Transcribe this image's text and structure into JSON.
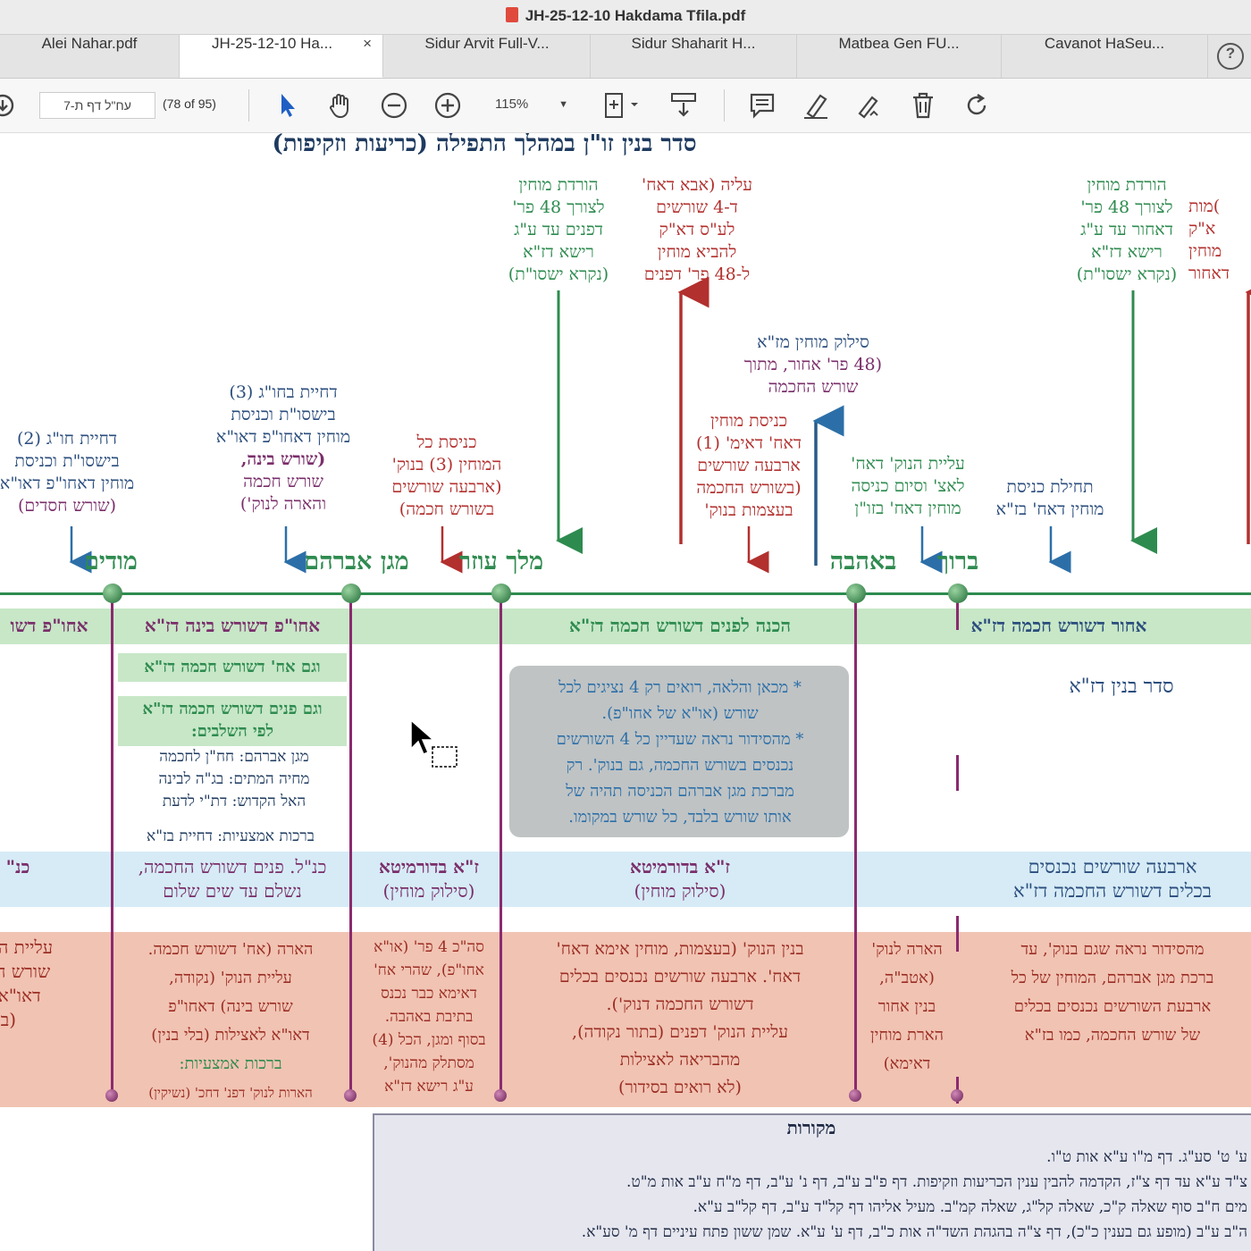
{
  "window": {
    "title": "JH-25-12-10 Hakdama Tfila.pdf"
  },
  "tabs": [
    {
      "label": "Alei Nahar.pdf"
    },
    {
      "label": "JH-25-12-10 Ha...",
      "active": true
    },
    {
      "label": "Sidur Arvit Full-V..."
    },
    {
      "label": "Sidur Shaharit H..."
    },
    {
      "label": "Matbea Gen FU..."
    },
    {
      "label": "Cavanot HaSeu..."
    }
  ],
  "toolbar": {
    "page_input": "עח\"ל דף ת-7",
    "page_count": "(78 of 95)",
    "zoom": "115%"
  },
  "doc": {
    "title": "סדר בנין זו\"ן במהלך התפילה (כריעות וזקיפות)",
    "top_labels": {
      "horadat1": [
        "הורדת מוחין",
        "לצורך 48 פר'",
        "דפנים עד ע\"ג",
        "רישא דז\"א",
        "(נקרא ישסו\"ת)"
      ],
      "aliya": [
        "עליה (אבא דאח'",
        "ד-4 שורשים",
        "לע\"ס דא\"ק",
        "להביא מוחין",
        "ל-48 פר' דפנים"
      ],
      "horadat2": [
        "הורדת מוחין",
        "לצורך 48 פר'",
        "דאחור עד ע\"ג",
        "רישא דז\"א",
        "(נקרא ישסו\"ת)"
      ],
      "edge_right": [
        ")מות",
        "א\"ק",
        "מוחין",
        "דאחור"
      ],
      "silluk": [
        "סילוק מוחין מז\"א",
        "(48 פר' אחור, מתוך",
        "שורש החכמה"
      ],
      "knisat_mochin": [
        "כניסת מוחין",
        "דאח' דאימ' (1)",
        "ארבעה שורשים",
        "(בשורש החכמה",
        "בעצמות בנוק'"
      ],
      "dchiyat3": [
        "דחיית בחו\"ג (3)",
        "בישסו\"ת וכניסת",
        "מוחין דאחו\"פ דאו\"א",
        "(שורש בינה,",
        "שורש חכמה",
        "והארה לנוק')"
      ],
      "dchiyat2": [
        "דחיית חו\"ג (2)",
        "בישסו\"ת וכניסת",
        "מוחין דאחו\"פ דאו\"א",
        "(שורש חסדים)"
      ],
      "knisat_kol": [
        "כניסת כל",
        "המוחין (3) בנוק'",
        "(ארבעה שורשים",
        "בשורש חכמה)"
      ],
      "aliyat_nukva": [
        "עליית הנוק' דאח'",
        "לאצ' וסיום כניסה",
        "מוחין דאח' בזו\"ן"
      ],
      "tchilat": [
        "תחילת כניסת",
        "מוחין דאח' בז\"א"
      ]
    },
    "stems": [
      "מודים",
      "מגן אברהם",
      "מלך עוזר",
      "באהבה",
      "ברוך"
    ],
    "band1": {
      "c1": "אחו\"פ דשו",
      "c2": "אחו\"פ דשורש בינה דז\"א",
      "c3": "הכנה לפנים דשורש חכמה דז\"א",
      "c4": "אחור דשורש חכמה דז\"א"
    },
    "side_notes": {
      "n1": "וגם אח' דשורש חכמה דז\"א",
      "n2a": "וגם פנים דשורש חכמה דז\"א",
      "n2b": "לפי השלבים:",
      "n3": [
        "מגן אברהם: חח\"ן לחכמה",
        "מחיה המתים: בג\"ה לבינה",
        "האל הקדוש: דת\"י לדעת"
      ],
      "n4": "ברכות אמצעיות: דחיית בז\"א"
    },
    "greybox": [
      "* מכאן והלאה, רואים רק 4 נציגים לכל",
      "שורש (או\"א של אחו\"פ).",
      "* מהסידור נראה שעדיין כל 4 השורשים",
      "נכנסים בשורש החכמה, גם בנוק'. רק",
      "מברכת מגן אברהם הכניסה תהיה של",
      "אותו שורש בלבד, כל שורש במקומו."
    ],
    "seder_binyan": "סדר בנין דז\"א",
    "band2": {
      "c1": "כנ\"",
      "c2a": "כנ\"ל. פנים דשורש החכמה,",
      "c2b": "נשלם עד שים שלום",
      "c3a": "ז\"א בדורמיטא",
      "c3b": "(סילוק מוחין)",
      "c4a": "ז\"א בדורמיטא",
      "c4b": "(סילוק מוחין)",
      "c5a": "ארבעה שורשים נכנסים",
      "c5b": "בכלים דשורש החכמה דז\"א"
    },
    "band3": {
      "c1": [
        "עליית הנוק'",
        "שורש חס')",
        "דאו\"א לא",
        "(בלי ב"
      ],
      "c2": [
        "הארה (אח' דשורש חכמה.",
        "עליית הנוק' (נקודה,",
        "שורש בינה) דאחו\"פ",
        "דאו\"א לאצילות (בלי בנין)",
        "ברכות אמצעיות:",
        "הארות לנוק' דפנ' דחכ' (נשיקין)"
      ],
      "c3": [
        "סה\"כ 4 פר' (או\"א",
        "אחו\"פ), שהרי אח'",
        "דאימא כבר נכנס",
        "בתיבת באהבה.",
        "בסוף ומגן, הכל (4)",
        "מסתלק מהנוק',",
        "ע\"ג רישא דז\"א"
      ],
      "c4": [
        "בנין הנוק' (בעצמות, מוחין אימא דאח'",
        "דאח'. ארבעה שורשים נכנסים בכלים",
        "דשורש החכמה דנוק').",
        "עליית הנוק' דפנים (בתור נקודה),",
        "מהבריאה לאצילות",
        "(לא רואים בסידור)"
      ],
      "c5": [
        "הארה לנוק'",
        "(אטב\"ה,",
        "בנין אחור",
        "הארת מוחין",
        "דאימא)"
      ],
      "c6": [
        "מהסידור נראה שגם בנוק', עד",
        "ברכת מגן אברהם, המוחין של כל",
        "ארבעת השורשים נכנסים בכלים",
        "של שורש החכמה, כמו בז\"א"
      ]
    },
    "sources": {
      "title": "מקורות",
      "lines": [
        "ע' ט' סע\"ג. דף מ\"ו ע\"א אות ט\"ו.",
        "צ\"ד ע\"א עד דף צ\"ז, הקדמה להבין ענין הכריעות וזקיפות. דף פ\"ב ע\"ב, דף נ' ע\"ב, דף מ\"ח ע\"ב אות מ\"ט.",
        "מים ח\"ב סוף שאלה ק\"כ, שאלה קל\"ג, שאלה קמ\"ב. מעיל אליהו דף קל\"ד ע\"ב, דף קל\"ב ע\"א.",
        "ה\"ב ע\"ב (מופע גם בענין כ\"כ), דף צ\"ה בהגהת השד\"ה אות כ\"ב, דף ע' ע\"א. שמן ששון פתח עיניים דף מ' סע\"א."
      ]
    }
  },
  "colors": {
    "green": "#2e8b4f",
    "red": "#b2302e",
    "navy": "#2a4d7d",
    "purple": "#8b2a6e",
    "band_green": "#c7e7c7",
    "band_blue": "#d6ebf6",
    "band_salmon": "#f1c3b3"
  }
}
